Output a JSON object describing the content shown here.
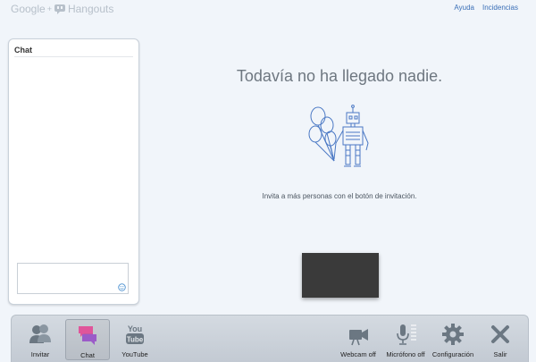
{
  "header": {
    "brand_google": "Google",
    "brand_plus": "+",
    "brand_hangouts": "Hangouts",
    "links": [
      "Ayuda",
      "Incidencias"
    ]
  },
  "chat_panel": {
    "title": "Chat",
    "input_value": ""
  },
  "main": {
    "message": "Todavía no ha llegado nadie.",
    "invite_hint": "Invita a más personas con el botón de invitación."
  },
  "toolbar": {
    "items": [
      {
        "label": "Invitar",
        "icon": "invite-people-icon",
        "active": false
      },
      {
        "label": "Chat",
        "icon": "chat-icon",
        "active": true
      },
      {
        "label": "YouTube",
        "icon": "youtube-icon",
        "active": false
      },
      {
        "label": "Webcam off",
        "icon": "webcam-icon",
        "active": false
      },
      {
        "label": "Micrófono off",
        "icon": "microphone-icon",
        "active": false
      },
      {
        "label": "Configuración",
        "icon": "gear-icon",
        "active": false
      },
      {
        "label": "Salir",
        "icon": "close-icon",
        "active": false
      }
    ]
  },
  "colors": {
    "background": "#f1f5fa",
    "link": "#3a6fb7",
    "chat_icon_pink": "#e0559a",
    "chat_icon_purple": "#9b5bc8",
    "preview": "#3a3a3a"
  }
}
